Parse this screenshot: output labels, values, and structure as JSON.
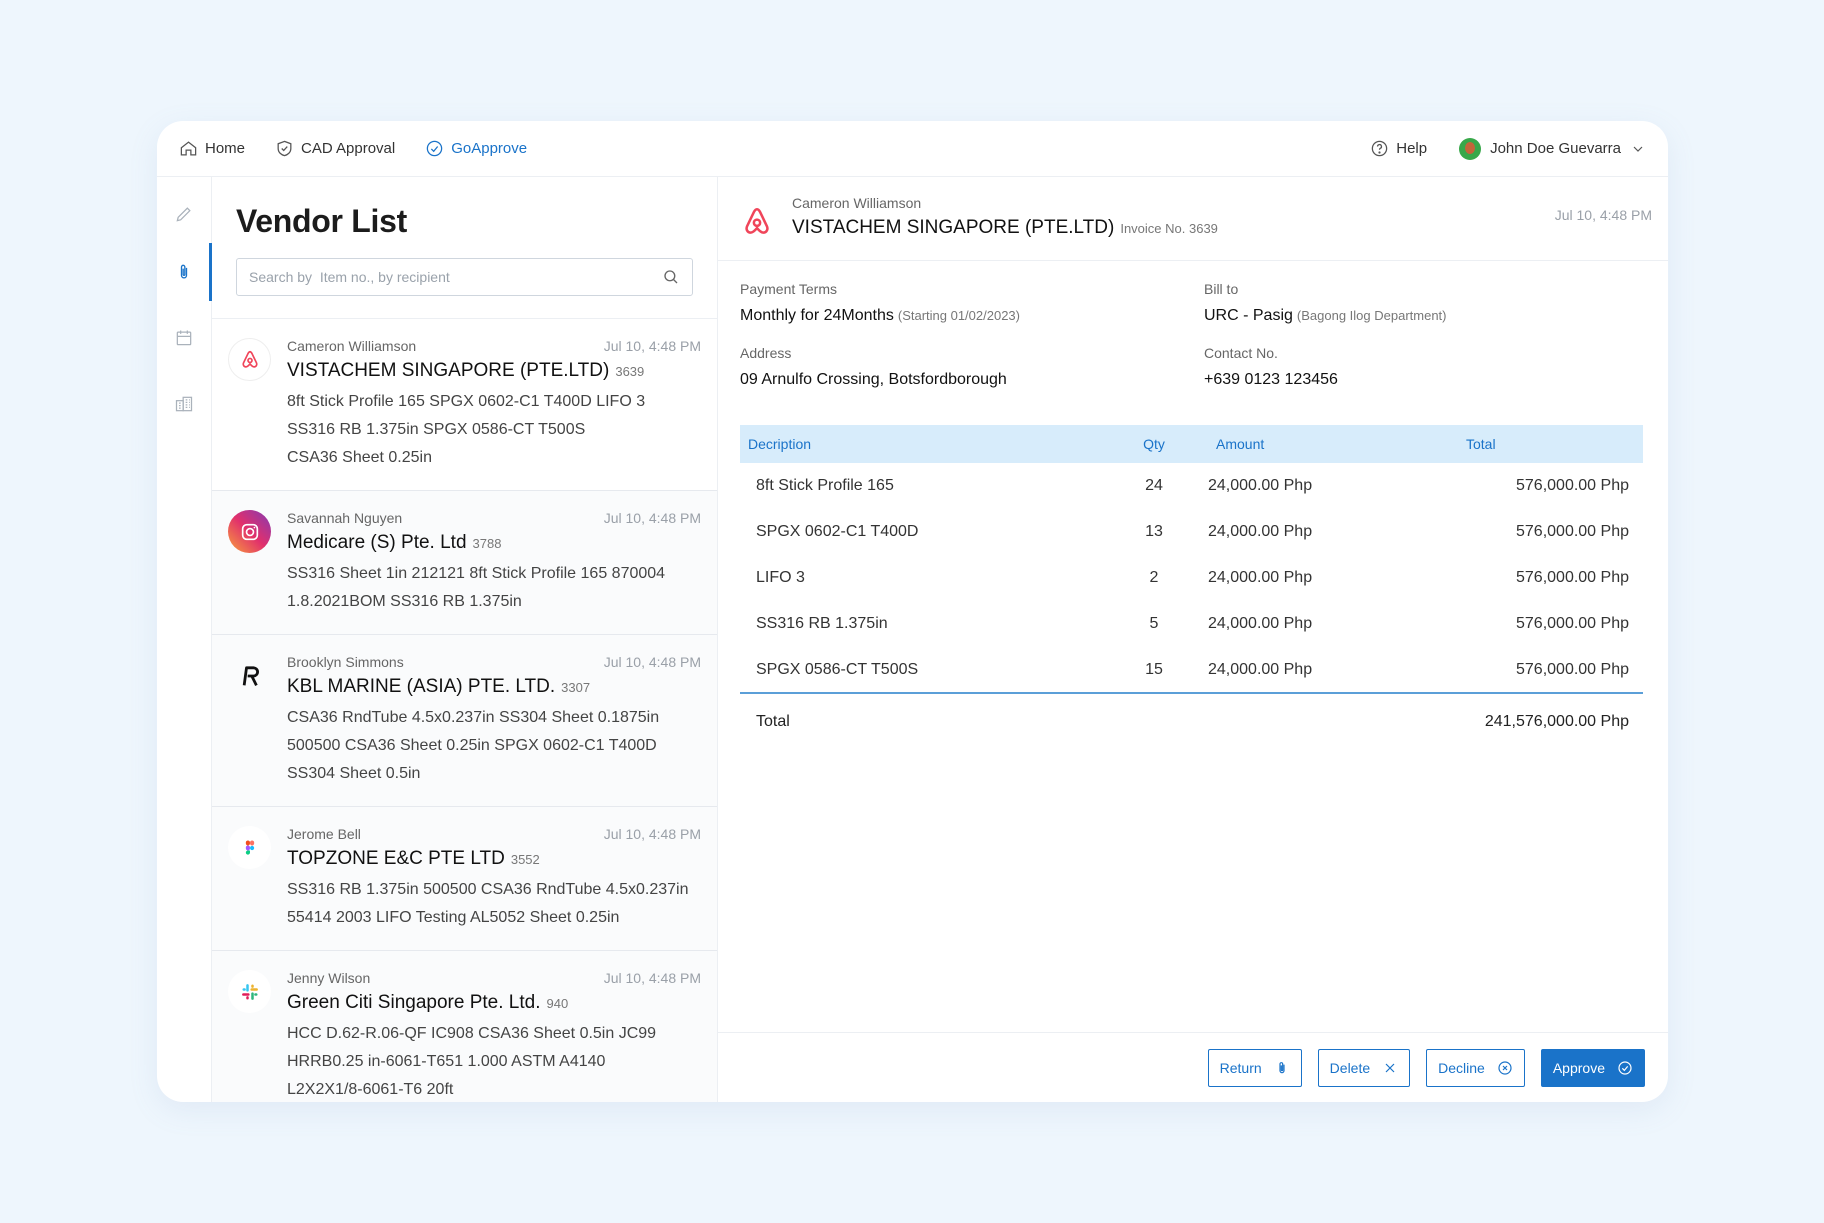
{
  "nav": {
    "home": "Home",
    "cad_approval": "CAD Approval",
    "goapprove": "GoApprove"
  },
  "topbar": {
    "help": "Help",
    "user_name": "John Doe Guevarra"
  },
  "list": {
    "title": "Vendor List",
    "search_placeholder": "Search by  Item no., by recipient",
    "vendors": [
      {
        "person": "Cameron Williamson",
        "date": "Jul 10, 4:48 PM",
        "company": "VISTACHEM SINGAPORE (PTE.LTD)",
        "number": "3639",
        "items_line1": "8ft Stick Profile 165  SPGX 0602-C1 T400D  LIFO 3",
        "items_line2": "SS316 RB 1.375in  SPGX 0586-CT T500S",
        "items_line3": "CSA36 Sheet 0.25in",
        "logo": "airbnb-logo"
      },
      {
        "person": "Savannah Nguyen",
        "date": "Jul 10, 4:48 PM",
        "company": "Medicare (S) Pte. Ltd",
        "number": "3788",
        "items_line1": "SS316 Sheet 1in  212121  8ft Stick Profile 165  870004",
        "items_line2": "1.8.2021BOM  SS316 RB 1.375in",
        "logo": "instagram-logo"
      },
      {
        "person": "Brooklyn Simmons",
        "date": "Jul 10, 4:48 PM",
        "company": "KBL MARINE (ASIA) PTE. LTD.",
        "number": "3307",
        "items_line1": "CSA36 RndTube 4.5x0.237in  SS304 Sheet 0.1875in",
        "items_line2": "500500  CSA36 Sheet 0.25in  SPGX 0602-C1 T400D",
        "items_line3": "SS304 Sheet 0.5in",
        "logo": "revolut-logo"
      },
      {
        "person": "Jerome Bell",
        "date": "Jul 10, 4:48 PM",
        "company": "TOPZONE E&C PTE LTD",
        "number": "3552",
        "items_line1": "SS316 RB 1.375in  500500  CSA36 RndTube 4.5x0.237in",
        "items_line2": "55414  2003 LIFO Testing  AL5052 Sheet 0.25in",
        "logo": "figma-logo"
      },
      {
        "person": "Jenny Wilson",
        "date": "Jul 10, 4:48 PM",
        "company": "Green Citi Singapore Pte. Ltd.",
        "number": "940",
        "items_line1": "HCC D.62-R.06-QF IC908  CSA36 Sheet 0.5in  JC99",
        "items_line2": "HRRB0.25 in-6061-T651  1.000 ASTM A4140",
        "items_line3": "L2X2X1/8-6061-T6 20ft",
        "logo": "slack-logo"
      }
    ]
  },
  "detail": {
    "person": "Cameron Williamson",
    "company": "VISTACHEM SINGAPORE (PTE.LTD)",
    "invoice": "Invoice No. 3639",
    "date": "Jul 10, 4:48 PM",
    "payment_terms_label": "Payment Terms",
    "payment_terms_value": "Monthly for 24Months",
    "payment_terms_sub": "(Starting 01/02/2023)",
    "bill_to_label": "Bill to",
    "bill_to_value": "URC - Pasig",
    "bill_to_sub": "(Bagong Ilog Department)",
    "address_label": "Address",
    "address_value": "09 Arnulfo Crossing, Botsfordborough",
    "contact_label": "Contact No.",
    "contact_value": "+639 0123 123456",
    "table": {
      "headers": [
        "Decription",
        "Qty",
        "Amount",
        "Total"
      ],
      "rows": [
        [
          "8ft Stick Profile 165",
          "24",
          "24,000.00 Php",
          "576,000.00 Php"
        ],
        [
          "SPGX 0602-C1 T400D",
          "13",
          "24,000.00 Php",
          "576,000.00 Php"
        ],
        [
          "LIFO 3",
          "2",
          "24,000.00 Php",
          "576,000.00 Php"
        ],
        [
          "SS316 RB 1.375in",
          "5",
          "24,000.00 Php",
          "576,000.00 Php"
        ],
        [
          "SPGX 0586-CT T500S",
          "15",
          "24,000.00 Php",
          "576,000.00 Php"
        ]
      ],
      "total_label": "Total",
      "total_value": "241,576,000.00 Php"
    },
    "actions": {
      "return": "Return",
      "delete": "Delete",
      "decline": "Decline",
      "approve": "Approve"
    }
  },
  "colors": {
    "accent": "#1a73c9",
    "table_header_bg": "#d7ecfb",
    "page_bg": "#eef6fd"
  }
}
